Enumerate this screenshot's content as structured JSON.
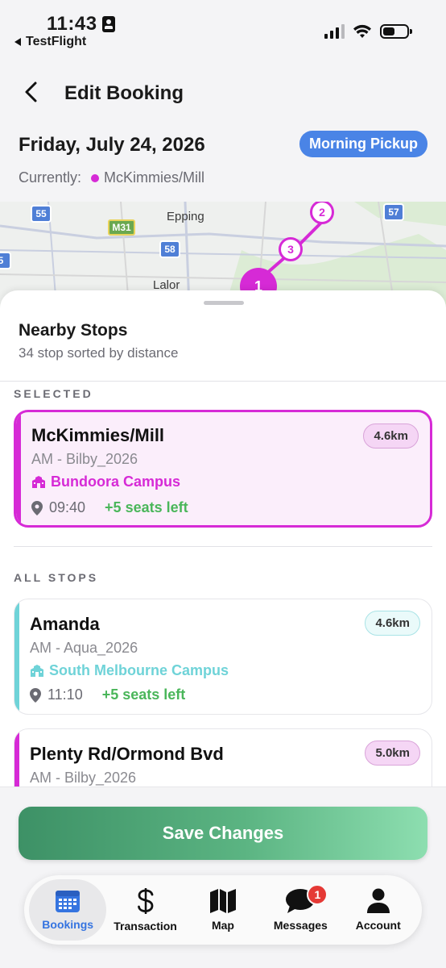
{
  "status_bar": {
    "time": "11:43",
    "back_app_label": "TestFlight"
  },
  "header": {
    "title": "Edit Booking"
  },
  "booking": {
    "date": "Friday, July 24, 2026",
    "pickup_label": "Morning Pickup",
    "currently_label": "Currently:",
    "current_stop": "McKimmies/Mill"
  },
  "map": {
    "places": [
      "Epping",
      "Lalor"
    ],
    "shields": [
      "55",
      "M31",
      "58",
      "57",
      "5"
    ],
    "pins": [
      "1",
      "2",
      "3"
    ]
  },
  "sheet": {
    "title": "Nearby Stops",
    "subtitle": "34 stop sorted by distance",
    "selected_label": "SELECTED",
    "all_label": "ALL STOPS",
    "selected": {
      "name": "McKimmies/Mill",
      "route": "AM - Bilby_2026",
      "campus": "Bundoora Campus",
      "time": "09:40",
      "seats": "+5 seats left",
      "distance": "4.6km",
      "color": "#d62ad6"
    },
    "stops": [
      {
        "name": "Amanda",
        "route": "AM - Aqua_2026",
        "campus": "South Melbourne Campus",
        "time": "11:10",
        "seats": "+5 seats left",
        "distance": "4.6km",
        "color": "#6fd3d8"
      },
      {
        "name": "Plenty Rd/Ormond Bvd",
        "route": "AM - Bilby_2026",
        "distance": "5.0km",
        "color": "#d62ad6"
      }
    ]
  },
  "actions": {
    "save_label": "Save Changes"
  },
  "tabs": [
    {
      "label": "Bookings",
      "icon": "calendar-icon",
      "active": true
    },
    {
      "label": "Transaction",
      "icon": "dollar-icon"
    },
    {
      "label": "Map",
      "icon": "map-icon"
    },
    {
      "label": "Messages",
      "icon": "chat-icon",
      "badge": "1"
    },
    {
      "label": "Account",
      "icon": "person-icon"
    }
  ]
}
